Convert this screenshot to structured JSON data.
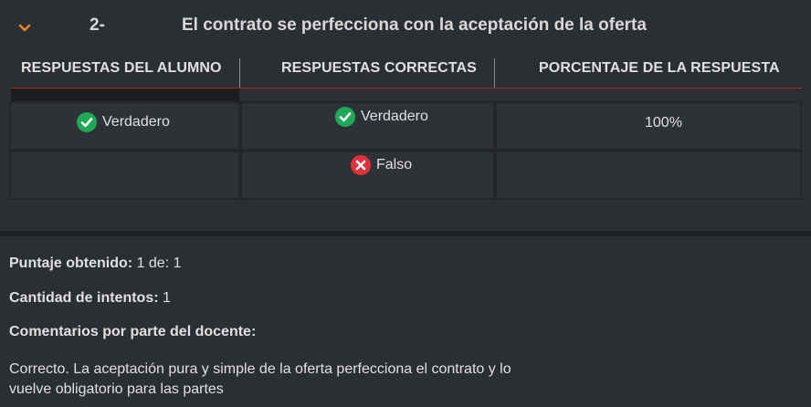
{
  "question": {
    "number": "2-",
    "title": "El contrato se perfecciona con la aceptación de la oferta",
    "collapse_icon": "chevron-down-icon",
    "accent_color": "#e08a2c"
  },
  "table": {
    "headers": [
      "RESPUESTAS DEL ALUMNO",
      "RESPUESTAS CORRECTAS",
      "PORCENTAJE DE LA RESPUESTA"
    ],
    "rule_color": "#b3261e",
    "student_answer": {
      "label": "Verdadero",
      "icon": "check-circle-icon"
    },
    "correct_answers": [
      {
        "label": "Verdadero",
        "icon": "check-circle-icon"
      },
      {
        "label": "Falso",
        "icon": "x-circle-icon"
      }
    ],
    "percentage": "100%",
    "colors": {
      "correct": "#1fa855",
      "incorrect": "#e0303a"
    }
  },
  "summary": {
    "score_label": "Puntaje obtenido:",
    "score_value": "1 de: 1",
    "attempts_label": "Cantidad de intentos:",
    "attempts_value": "1",
    "comments_label": "Comentarios por parte del docente:",
    "comment_line1": "Correcto. La aceptación pura y simple de la oferta perfecciona el contrato y lo",
    "comment_line2": "vuelve obligatorio para las partes"
  }
}
